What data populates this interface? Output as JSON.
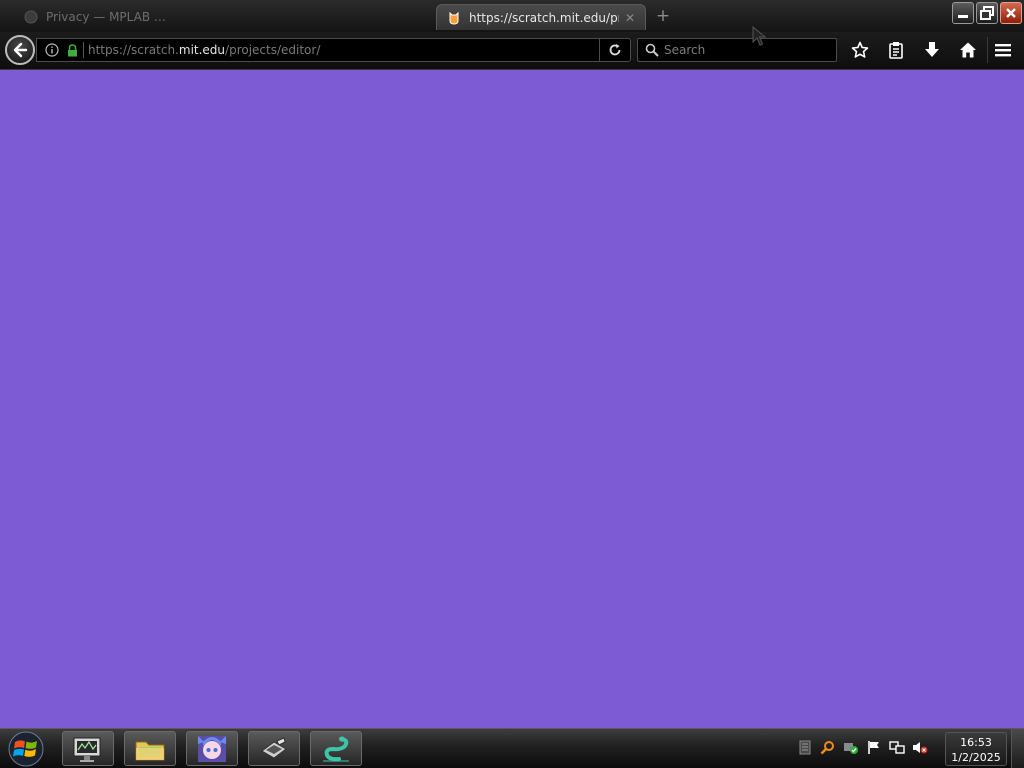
{
  "browser": {
    "tabs": [
      {
        "title": "Privacy — MPLAB …",
        "active": false
      },
      {
        "title": "https://scratch.mit.edu/projects/editor/",
        "active": true
      }
    ],
    "url": {
      "scheme_prefix": "https://scratch.",
      "domain": "mit.edu",
      "path": "/projects/editor/"
    },
    "search": {
      "placeholder": "Search",
      "value": ""
    }
  },
  "content": {
    "background_color": "#7d5bd4"
  },
  "taskbar": {
    "pinned": [
      {
        "name": "system-monitor-app"
      },
      {
        "name": "file-explorer-app"
      },
      {
        "name": "anime-avatar-app"
      },
      {
        "name": "tools-app"
      },
      {
        "name": "snake-app"
      }
    ],
    "clock": {
      "time": "16:53",
      "date": "1/2/2025"
    }
  },
  "colors": {
    "chrome_dark": "#141414",
    "page_purple": "#7d5bd4",
    "lock_green": "#3fae3f",
    "favicon_orange": "#f6a23b"
  }
}
